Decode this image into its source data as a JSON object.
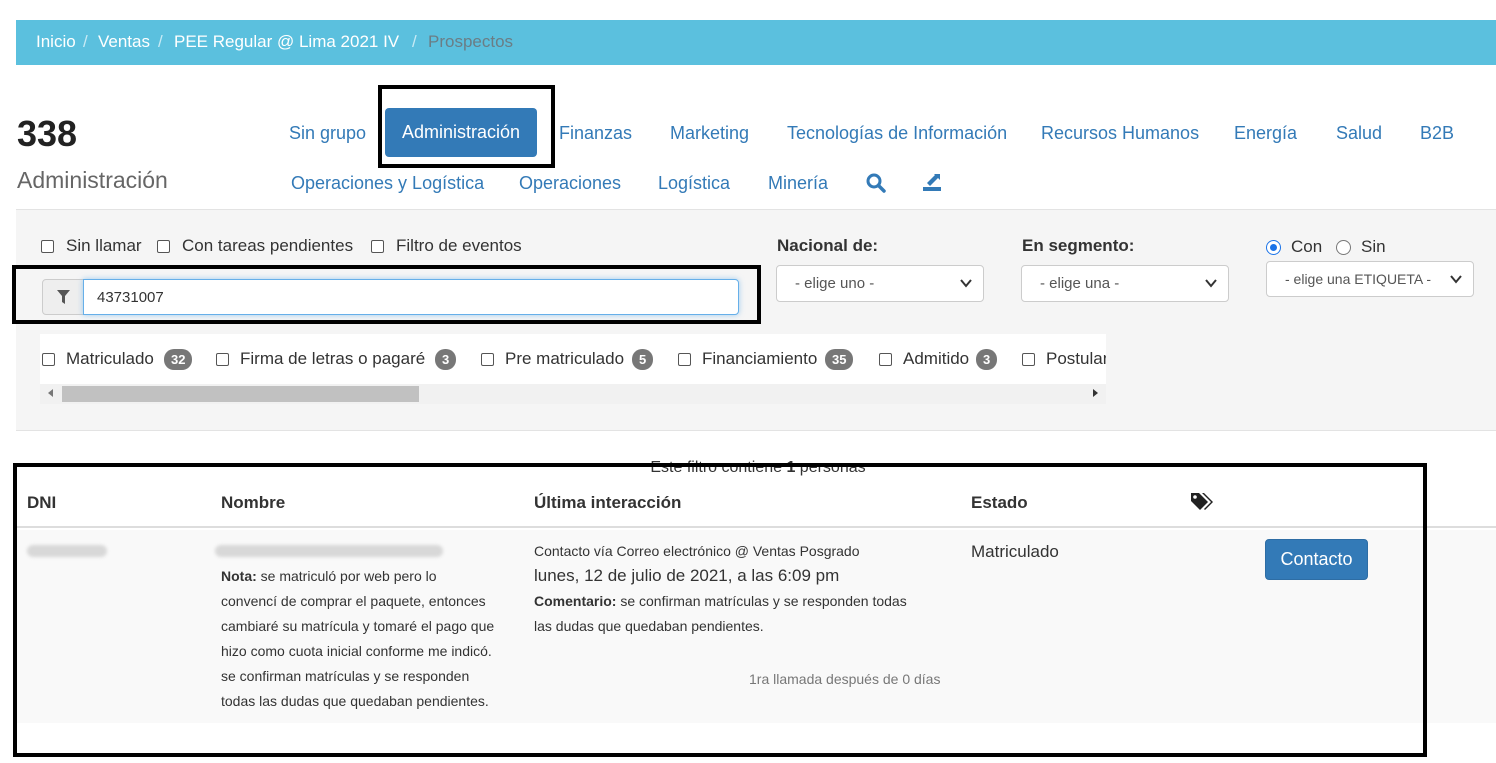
{
  "breadcrumb": {
    "items": [
      "Inicio",
      "Ventas",
      "PEE Regular @ Lima 2021 IV"
    ],
    "active": "Prospectos",
    "separator": "/"
  },
  "header": {
    "count": "338",
    "subtitle": "Administración"
  },
  "nav": {
    "row1": [
      "Sin grupo",
      "Administración",
      "Finanzas",
      "Marketing",
      "Tecnologías de Información",
      "Recursos Humanos",
      "Energía",
      "Salud",
      "B2B"
    ],
    "row2": [
      "Operaciones y Logística",
      "Operaciones",
      "Logística",
      "Minería"
    ],
    "active": "Administración",
    "icons": [
      "search-icon",
      "export-icon"
    ]
  },
  "filters": {
    "checkboxes": [
      "Sin llamar",
      "Con tareas pendientes",
      "Filtro de eventos"
    ],
    "search_value": "43731007",
    "nacional": {
      "label": "Nacional de:",
      "selected": "- elige uno -"
    },
    "segmento": {
      "label": "En segmento:",
      "selected": "- elige una -"
    },
    "etiqueta": {
      "radio_con": "Con",
      "radio_sin": "Sin",
      "radio_selected": "Con",
      "selected": "- elige una ETIQUETA -"
    },
    "stages": [
      {
        "label": "Matriculado",
        "count": "32"
      },
      {
        "label": "Firma de letras o pagaré",
        "count": "3"
      },
      {
        "label": "Pre matriculado",
        "count": "5"
      },
      {
        "label": "Financiamiento",
        "count": "35"
      },
      {
        "label": "Admitido",
        "count": "3"
      },
      {
        "label": "Postulan",
        "count": ""
      }
    ]
  },
  "results": {
    "summary_pre": "Este filtro contiene",
    "summary_count": "1",
    "summary_post": "personas",
    "columns": {
      "dni": "DNI",
      "nombre": "Nombre",
      "ultima": "Última interacción",
      "estado": "Estado"
    },
    "row": {
      "nota_label": "Nota:",
      "nota_lines": [
        "se matriculó por web pero lo",
        "convencí de comprar el paquete, entonces",
        "cambiaré su matrícula y tomaré el pago que",
        "hizo como cuota inicial conforme me indicó.",
        "se confirman matrículas y se responden",
        "todas las dudas que quedaban pendientes."
      ],
      "interaccion_via": "Contacto vía Correo electrónico @ Ventas Posgrado",
      "interaccion_fecha": "lunes, 12 de julio de 2021, a las 6:09 pm",
      "comentario_label": "Comentario:",
      "comentario_line1": "se confirman matrículas y se responden todas",
      "comentario_line2": "las dudas que quedaban pendientes.",
      "primera_llamada": "1ra llamada después de 0 días",
      "estado": "Matriculado",
      "action": "Contacto"
    }
  },
  "colors": {
    "breadcrumb_bg": "#5bc0de",
    "primary": "#337ab7",
    "badge": "#777777",
    "panel_bg": "#f5f5f5"
  }
}
